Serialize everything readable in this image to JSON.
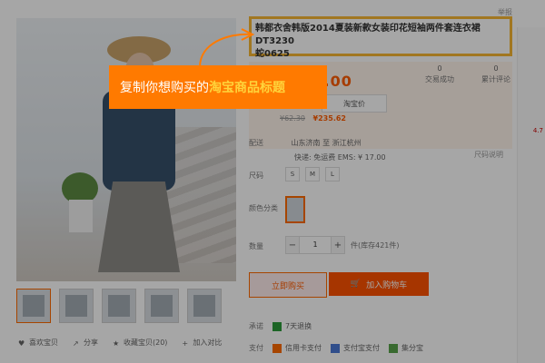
{
  "title_box": {
    "text": "韩都衣舍韩版2014夏装新款女装印花短袖两件套连衣裙DT3230\n蛇0625",
    "report_label": "举报"
  },
  "price": {
    "main_price": "¥299.00",
    "stats": [
      {
        "label": "交易成功",
        "value": "0"
      },
      {
        "label": "累计评论",
        "value": "0"
      }
    ],
    "taobao_button": "淘宝价",
    "promo_old": "¥62.30",
    "promo_new": "¥235.62"
  },
  "shipping": {
    "label": "配送",
    "from": "山东济南 至 浙江杭州",
    "fee": "快递: 免运费 EMS: ¥ 17.00"
  },
  "links": {
    "view_more": "尺码说明"
  },
  "sku": {
    "size_label": "尺码",
    "sizes": [
      "S",
      "M",
      "L"
    ],
    "color_label": "颜色分类",
    "quantity_label": "数量",
    "quantity_value": "1",
    "stock_text": "件(库存421件)"
  },
  "actions": {
    "buy_now": "立即购买",
    "add_to_cart": "加入购物车"
  },
  "promises": {
    "label": "承诺",
    "items": [
      "7天退换"
    ]
  },
  "payment": {
    "label": "支付",
    "methods": [
      "信用卡支付",
      "支付宝支付",
      "集分宝"
    ]
  },
  "share_row": {
    "items": [
      "喜欢宝贝",
      "分享",
      "收藏宝贝(20)",
      "加入对比"
    ]
  },
  "callout": {
    "prefix": "复制你想购买的",
    "highlight": "淘宝商品标题"
  },
  "side": {
    "note": "4.7"
  },
  "colors": {
    "brand_orange": "#ff6a00",
    "price_orange": "#ff5c00",
    "title_border": "#f7b733",
    "callout_bg": "#ff7a00",
    "callout_highlight": "#ffd43b"
  }
}
